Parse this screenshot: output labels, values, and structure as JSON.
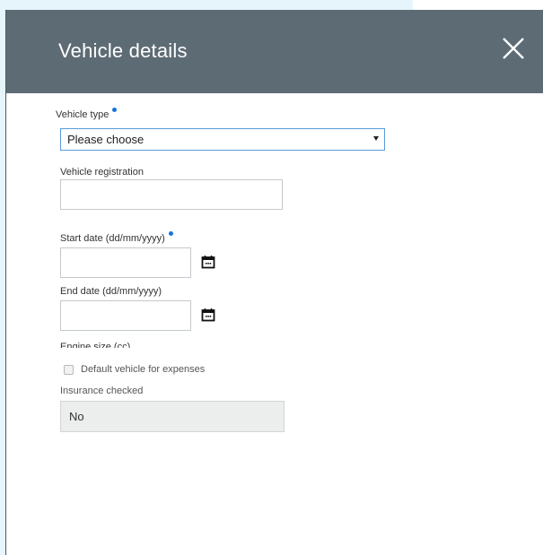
{
  "modal": {
    "title": "Vehicle details",
    "close_icon": "close-icon"
  },
  "form": {
    "vehicle_type": {
      "label": "Vehicle type",
      "selected": "Please choose"
    },
    "vehicle_registration": {
      "label": "Vehicle registration",
      "value": ""
    },
    "start_date": {
      "label": "Start date (dd/mm/yyyy)",
      "value": "",
      "icon": "calendar-icon"
    },
    "end_date": {
      "label": "End date (dd/mm/yyyy)",
      "value": "",
      "icon": "calendar-icon"
    },
    "engine_size": {
      "label": "Engine size (cc)"
    },
    "default_vehicle": {
      "label": "Default vehicle for expenses",
      "checked": false
    },
    "insurance_checked": {
      "label": "Insurance checked",
      "value": "No"
    }
  },
  "colors": {
    "header": "#5d6b74",
    "required_dot": "#1a73d9",
    "select_border": "#5a9bd8"
  }
}
